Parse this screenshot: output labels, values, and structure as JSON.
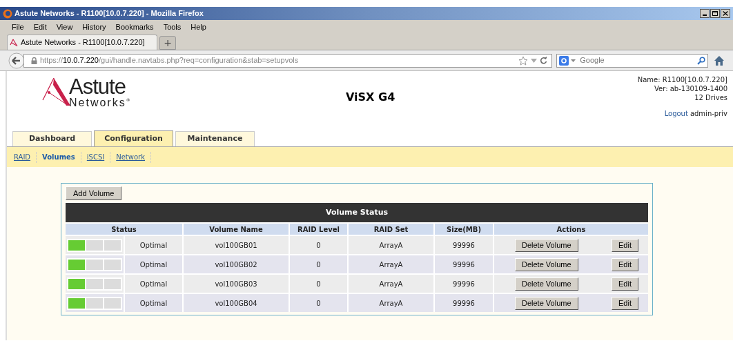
{
  "window": {
    "title": "Astute Networks - R1100[10.0.7.220] - Mozilla Firefox"
  },
  "menu": [
    "File",
    "Edit",
    "View",
    "History",
    "Bookmarks",
    "Tools",
    "Help"
  ],
  "browser_tabs": [
    {
      "label": "Astute Networks - R1100[10.0.7.220]",
      "selected": true
    }
  ],
  "new_tab": "+",
  "address": {
    "scheme": "https://",
    "host": "10.0.7.220",
    "path": "/gui/handle.navtabs.php?req=configuration&stab=setupvols"
  },
  "search": {
    "placeholder": "Google"
  },
  "header": {
    "logo_top": "Astute",
    "logo_bottom": "Networks",
    "logo_mark": "®",
    "product": "ViSX G4",
    "info": [
      "Name: R1100[10.0.7.220]",
      "Ver: ab-130109-1400",
      "12 Drives"
    ],
    "logout": "Logout",
    "user": "admin-priv"
  },
  "tabs": [
    {
      "label": "Dashboard",
      "selected": false
    },
    {
      "label": "Configuration",
      "selected": true
    },
    {
      "label": "Maintenance",
      "selected": false
    }
  ],
  "subtabs": [
    {
      "label": "RAID",
      "selected": false
    },
    {
      "label": "Volumes",
      "selected": true
    },
    {
      "label": "iSCSI",
      "selected": false
    },
    {
      "label": "Network",
      "selected": false
    }
  ],
  "add_button": "Add Volume",
  "table": {
    "title": "Volume Status",
    "columns": [
      "Status",
      "Volume Name",
      "RAID Level",
      "RAID Set",
      "Size(MB)",
      "Actions"
    ],
    "rows": [
      {
        "level": 0.33,
        "status": "Optimal",
        "name": "vol100GB01",
        "raid_level": "0",
        "raid_set": "ArrayA",
        "size": "99996",
        "delete": "Delete Volume",
        "edit": "Edit"
      },
      {
        "level": 0.33,
        "status": "Optimal",
        "name": "vol100GB02",
        "raid_level": "0",
        "raid_set": "ArrayA",
        "size": "99996",
        "delete": "Delete Volume",
        "edit": "Edit"
      },
      {
        "level": 0.33,
        "status": "Optimal",
        "name": "vol100GB03",
        "raid_level": "0",
        "raid_set": "ArrayA",
        "size": "99996",
        "delete": "Delete Volume",
        "edit": "Edit"
      },
      {
        "level": 0.33,
        "status": "Optimal",
        "name": "vol100GB04",
        "raid_level": "0",
        "raid_set": "ArrayA",
        "size": "99996",
        "delete": "Delete Volume",
        "edit": "Edit"
      }
    ]
  }
}
